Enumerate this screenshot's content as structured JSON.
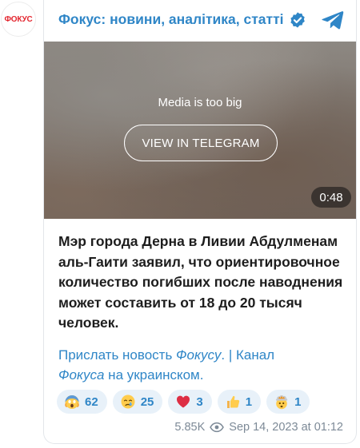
{
  "channel": {
    "avatar_text": "ФОКУС",
    "title": "Фокус: новини, аналітика, статті"
  },
  "media": {
    "note": "Media is too big",
    "button_label": "VIEW IN TELEGRAM",
    "duration": "0:48"
  },
  "post": {
    "text": "Мэр города Дерна в Ливии Абдулменам аль-Гаити заявил, что ориентировочное количество погибших после наводнения может составить от 18 до 20 тысяч человек.",
    "link1_a": "Прислать новость ",
    "link1_b": "Фокусу",
    "link1_c": ".",
    "separator": " | ",
    "link2_a": "Канал ",
    "link2_b": "Фокуса",
    "link2_c": " на украинском."
  },
  "reactions": [
    {
      "icon": "scream-face",
      "count": "62"
    },
    {
      "icon": "crying-face",
      "count": "25"
    },
    {
      "icon": "red-heart",
      "count": "3"
    },
    {
      "icon": "thumbs-up",
      "count": "1"
    },
    {
      "icon": "exploding-head",
      "count": "1"
    }
  ],
  "meta": {
    "views": "5.85K",
    "date": "Sep 14, 2023 at 01:12"
  },
  "colors": {
    "accent": "#2f86c7",
    "brand_red": "#e3262f",
    "reaction_bg": "#e8f1f9"
  }
}
